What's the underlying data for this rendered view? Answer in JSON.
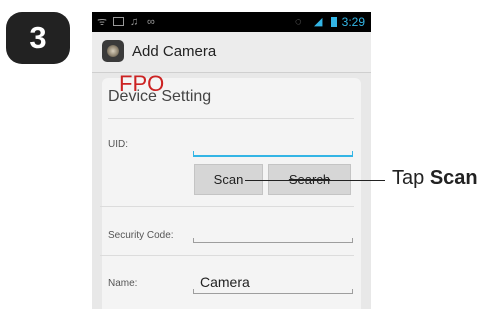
{
  "step": {
    "number": "3"
  },
  "status_bar": {
    "time": "3:29",
    "left_glyphs": "ᯤ",
    "headphones": "♫",
    "voicemail": "∞"
  },
  "action_bar": {
    "title": "Add Camera"
  },
  "form": {
    "section_title": "Device Setting",
    "overlay_text": "FPO",
    "uid": {
      "label": "UID:",
      "value": ""
    },
    "scan_button": "Scan",
    "search_button": "Search",
    "security_code": {
      "label": "Security Code:",
      "value": ""
    },
    "name": {
      "label": "Name:",
      "value": "Camera"
    }
  },
  "callout": {
    "prefix": "Tap ",
    "target": "Scan"
  },
  "colors": {
    "accent": "#33b5e5",
    "fpo": "#cc2222",
    "badge": "#222222"
  }
}
